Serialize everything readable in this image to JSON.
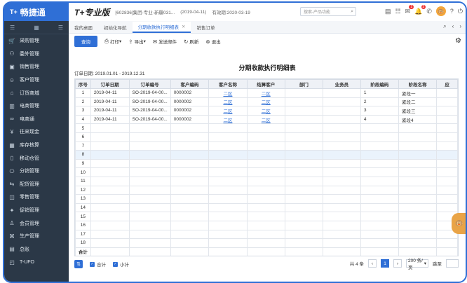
{
  "sidebar": {
    "logo_mark": "T+",
    "logo_text": "畅捷通",
    "items": [
      {
        "label": "采购管理",
        "icon": "cart-icon"
      },
      {
        "label": "委外管理",
        "icon": "handshake-icon"
      },
      {
        "label": "销售管理",
        "icon": "sales-icon"
      },
      {
        "label": "客户管理",
        "icon": "user-icon"
      },
      {
        "label": "订货商城",
        "icon": "store-icon"
      },
      {
        "label": "电商管理",
        "icon": "ecommerce-icon"
      },
      {
        "label": "电商通",
        "icon": "link-icon"
      },
      {
        "label": "往来现金",
        "icon": "cash-icon"
      },
      {
        "label": "库存核算",
        "icon": "inventory-icon"
      },
      {
        "label": "移动仓管",
        "icon": "mobile-icon"
      },
      {
        "label": "分销管理",
        "icon": "distribution-icon"
      },
      {
        "label": "配货管理",
        "icon": "delivery-icon"
      },
      {
        "label": "零售管理",
        "icon": "retail-icon"
      },
      {
        "label": "促销管理",
        "icon": "promotion-icon"
      },
      {
        "label": "会员管理",
        "icon": "member-icon"
      },
      {
        "label": "生产管理",
        "icon": "factory-icon"
      },
      {
        "label": "总账",
        "icon": "ledger-icon"
      },
      {
        "label": "T-UFO",
        "icon": "report-icon"
      }
    ]
  },
  "topbar": {
    "brand": "T+专业版",
    "company": "[602836]集团-专业-新疆031...",
    "login_date": "(2019-04-11)",
    "valid_until": "有效期:2020-03-19",
    "search_placeholder": "搜索-产品功能",
    "badge_messages": "1",
    "badge_alerts": "2"
  },
  "tabs": [
    {
      "label": "我的桌面",
      "active": false
    },
    {
      "label": "初始化导航",
      "active": false
    },
    {
      "label": "分期收款执行明细表",
      "active": true
    },
    {
      "label": "销售订单",
      "active": false
    }
  ],
  "toolbar": {
    "query": "查询",
    "print": "打印",
    "export": "导出",
    "send_mail": "发送邮件",
    "refresh": "刷新",
    "exit": "退出"
  },
  "report": {
    "title": "分期收款执行明细表",
    "date_range": "订单日期: 2019.01.01 - 2019.12.31",
    "columns": [
      "序号",
      "订单日期",
      "订单编号",
      "客户编码",
      "客户名称",
      "结算客户",
      "部门",
      "业务员",
      "阶段编码",
      "阶段名称",
      "应"
    ],
    "rows": [
      [
        "1",
        "2019-04-11",
        "SO-2019-04-00...",
        "0000002",
        "二区",
        "二区",
        "",
        "",
        "1",
        "紧段一",
        ""
      ],
      [
        "2",
        "2019-04-11",
        "SO-2019-04-00...",
        "0000002",
        "二区",
        "二区",
        "",
        "",
        "2",
        "紧段二",
        ""
      ],
      [
        "3",
        "2019-04-11",
        "SO-2019-04-00...",
        "0000002",
        "二区",
        "二区",
        "",
        "",
        "3",
        "紧段三",
        ""
      ],
      [
        "4",
        "2019-04-11",
        "SO-2019-04-00...",
        "0000002",
        "二区",
        "二区",
        "",
        "",
        "4",
        "紧段4",
        ""
      ],
      [
        "5",
        "",
        "",
        "",
        "",
        "",
        "",
        "",
        "",
        "",
        ""
      ],
      [
        "6",
        "",
        "",
        "",
        "",
        "",
        "",
        "",
        "",
        "",
        ""
      ],
      [
        "7",
        "",
        "",
        "",
        "",
        "",
        "",
        "",
        "",
        "",
        ""
      ],
      [
        "8",
        "",
        "",
        "",
        "",
        "",
        "",
        "",
        "",
        "",
        ""
      ],
      [
        "9",
        "",
        "",
        "",
        "",
        "",
        "",
        "",
        "",
        "",
        ""
      ],
      [
        "10",
        "",
        "",
        "",
        "",
        "",
        "",
        "",
        "",
        "",
        ""
      ],
      [
        "11",
        "",
        "",
        "",
        "",
        "",
        "",
        "",
        "",
        "",
        ""
      ],
      [
        "12",
        "",
        "",
        "",
        "",
        "",
        "",
        "",
        "",
        "",
        ""
      ],
      [
        "13",
        "",
        "",
        "",
        "",
        "",
        "",
        "",
        "",
        "",
        ""
      ],
      [
        "14",
        "",
        "",
        "",
        "",
        "",
        "",
        "",
        "",
        "",
        ""
      ],
      [
        "15",
        "",
        "",
        "",
        "",
        "",
        "",
        "",
        "",
        "",
        ""
      ],
      [
        "16",
        "",
        "",
        "",
        "",
        "",
        "",
        "",
        "",
        "",
        ""
      ],
      [
        "17",
        "",
        "",
        "",
        "",
        "",
        "",
        "",
        "",
        "",
        ""
      ],
      [
        "18",
        "",
        "",
        "",
        "",
        "",
        "",
        "",
        "",
        "",
        ""
      ]
    ],
    "total_label": "合计"
  },
  "footer": {
    "subtotal_opt": "合计",
    "subtotal2_opt": "小计",
    "count_text": "共 4 条",
    "prev": "‹",
    "page": "1",
    "next": "›",
    "page_size": "200 条/页",
    "goto_label": "跳至",
    "goto_value": ""
  },
  "colors": {
    "accent": "#2f6fd6",
    "sidebar": "#2b3847"
  }
}
